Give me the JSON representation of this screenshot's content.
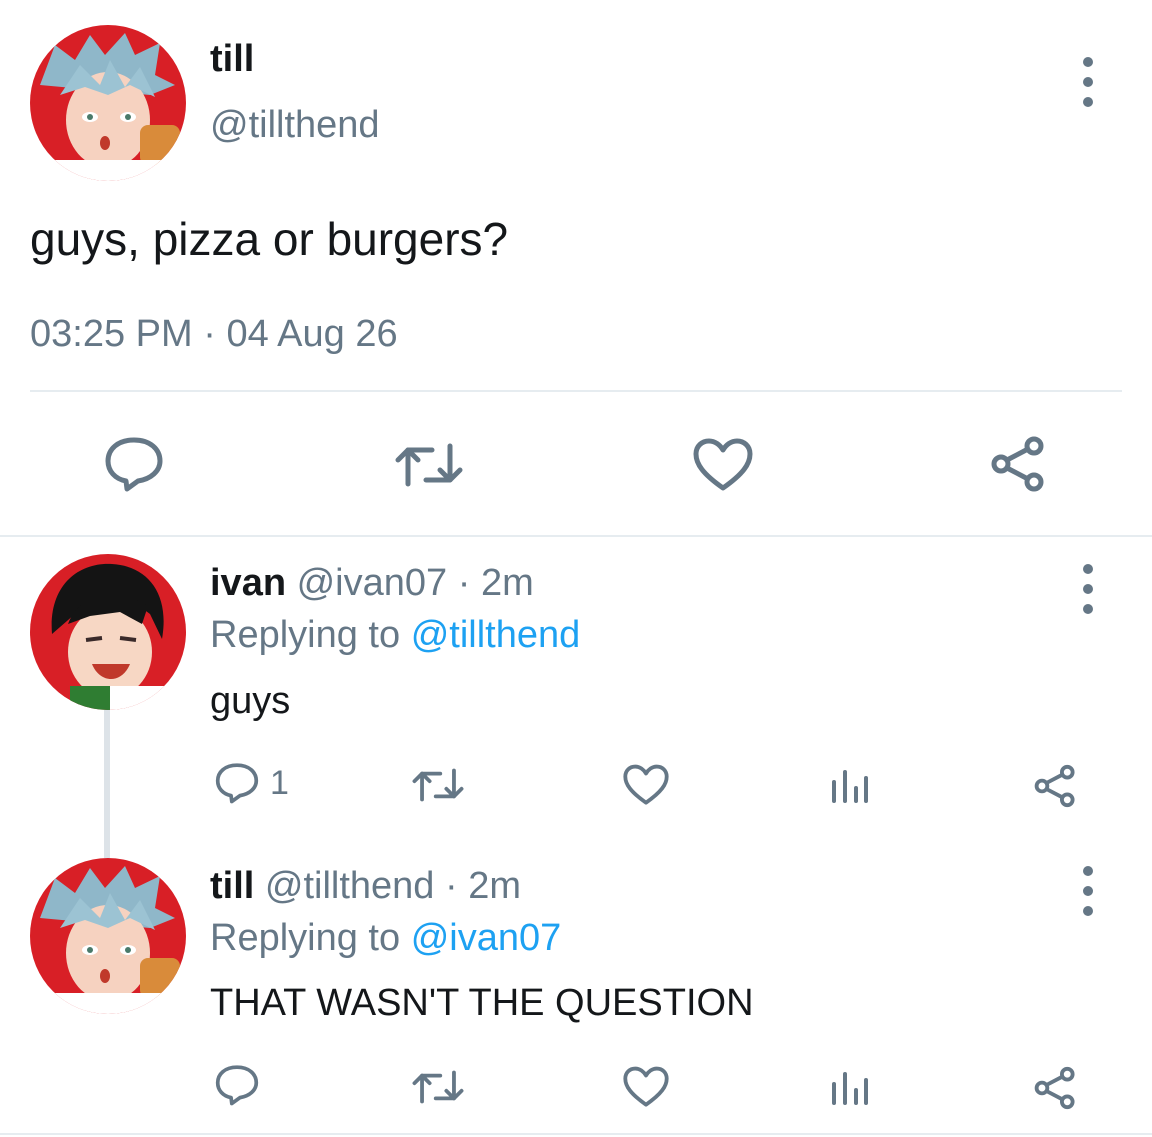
{
  "main_tweet": {
    "name": "till",
    "handle": "@tillthend",
    "text": "guys, pizza or burgers?",
    "time": "03:25 PM",
    "separator": "·",
    "date": "04 Aug 26"
  },
  "replies": [
    {
      "name": "ivan",
      "handle": "@ivan07",
      "separator": "·",
      "age": "2m",
      "replying_prefix": "Replying to",
      "replying_to": "@tillthend",
      "text": "guys",
      "reply_count": "1"
    },
    {
      "name": "till",
      "handle": "@tillthend",
      "separator": "·",
      "age": "2m",
      "replying_prefix": "Replying to",
      "replying_to": "@ivan07",
      "text": "THAT WASN'T THE QUESTION",
      "reply_count": ""
    }
  ],
  "colors": {
    "text": "#14171a",
    "muted": "#657786",
    "link": "#1da1f2",
    "divider": "#e6ecf0",
    "avatar_bg": "#d81f26"
  },
  "icons": [
    "reply-icon",
    "retweet-icon",
    "like-icon",
    "share-icon",
    "stats-icon",
    "more-icon"
  ]
}
